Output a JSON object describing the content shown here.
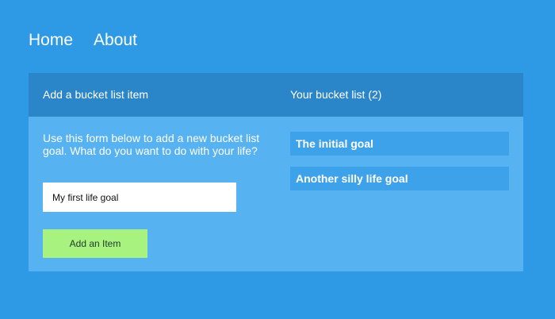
{
  "nav": {
    "items": [
      {
        "label": "Home"
      },
      {
        "label": "About"
      }
    ]
  },
  "form": {
    "title": "Add a bucket list item",
    "description": "Use this form below to add a new bucket list goal. What do you want to do with your life?",
    "input": {
      "value": "My first life goal",
      "placeholder": ""
    },
    "button_label": "Add an Item"
  },
  "bucket_list": {
    "title": "Your bucket list (2)",
    "items": [
      {
        "label": "The initial goal"
      },
      {
        "label": "Another silly life goal"
      }
    ]
  },
  "colors": {
    "page_background": "#2e9ae6",
    "panel_header": "#2a86c8",
    "panel_body": "#57b2f2",
    "list_item": "#3ea2ea",
    "button": "#a8f37f"
  }
}
